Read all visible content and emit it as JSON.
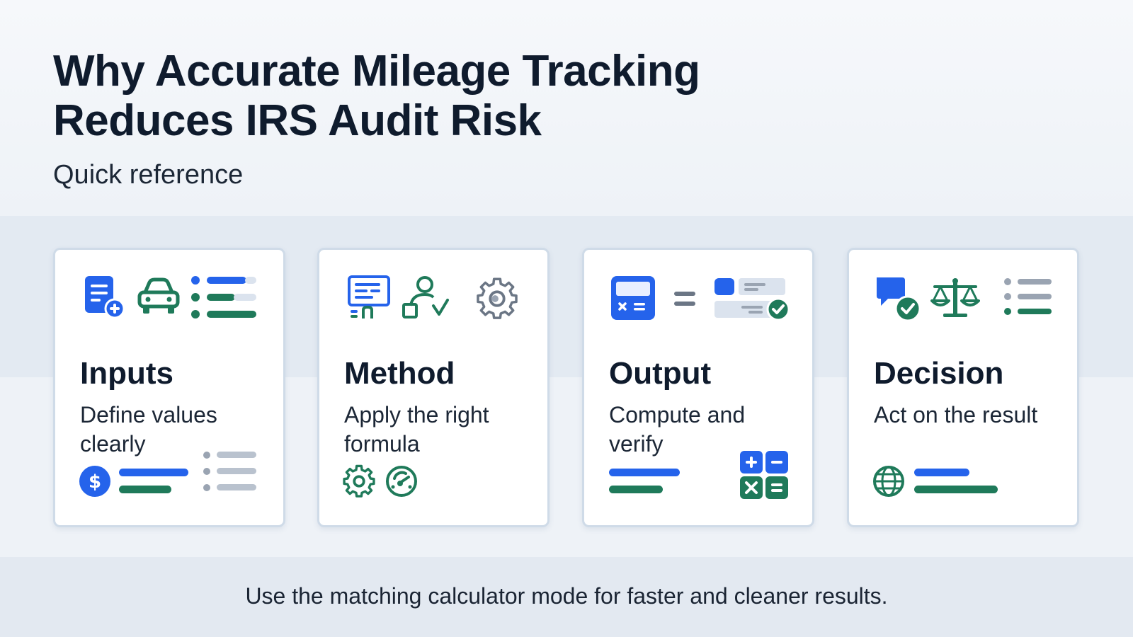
{
  "header": {
    "title": "Why Accurate Mileage Tracking Reduces IRS Audit Risk",
    "subtitle": "Quick reference"
  },
  "cards": [
    {
      "title": "Inputs",
      "description": "Define values clearly"
    },
    {
      "title": "Method",
      "description": "Apply the right formula"
    },
    {
      "title": "Output",
      "description": "Compute and verify"
    },
    {
      "title": "Decision",
      "description": "Act on the result"
    }
  ],
  "footer": {
    "text": "Use the matching calculator mode for faster and cleaner results."
  },
  "colors": {
    "accent_blue": "#2563eb",
    "accent_green": "#1f7a5a",
    "muted_gray": "#9aa4b2",
    "text_dark": "#0f1b2d"
  },
  "icons": {
    "inputs": [
      "document-add-icon",
      "car-icon",
      "list-icon",
      "dollar-icon",
      "list-icon"
    ],
    "method": [
      "formula-doc-icon",
      "person-check-icon",
      "gear-icon",
      "gear-icon",
      "gauge-icon"
    ],
    "output": [
      "calculator-icon",
      "equals-icon",
      "result-check-icon",
      "calculator-keys-icon"
    ],
    "decision": [
      "chat-check-icon",
      "scales-icon",
      "list-icon",
      "globe-icon"
    ]
  }
}
